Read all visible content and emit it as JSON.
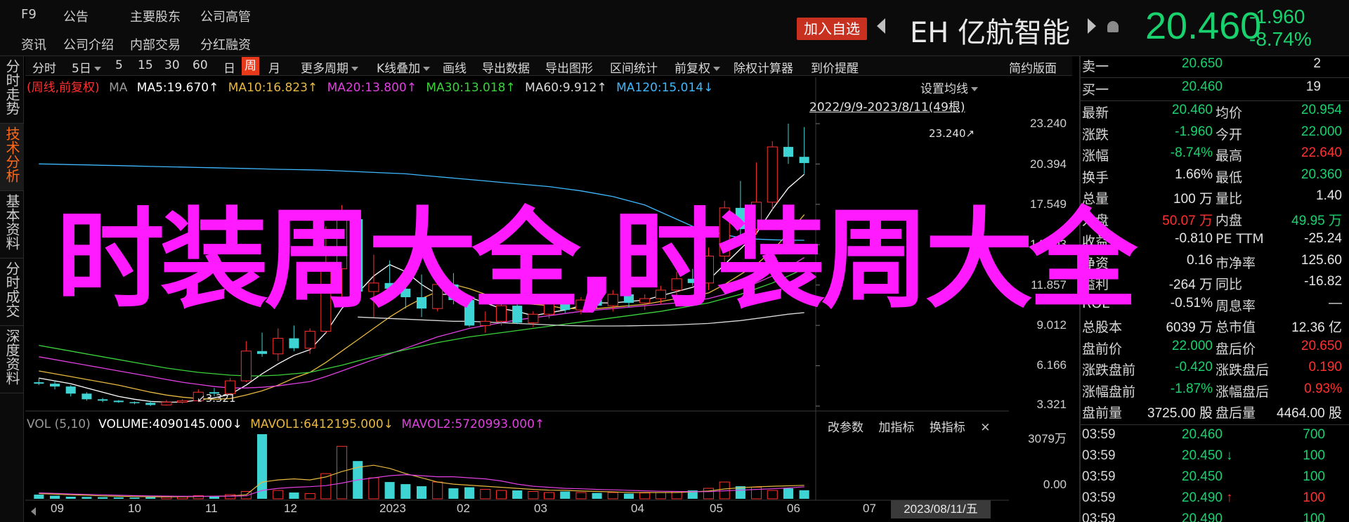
{
  "topnav": [
    "F9",
    "公告",
    "主要股东",
    "公司高管",
    "资讯",
    "公司介绍",
    "内部交易",
    "分红融资"
  ],
  "add_watch_label": "加入自选",
  "stock": {
    "code": "EH",
    "name": "亿航智能",
    "price": "20.460",
    "change": "-1.960",
    "change_pct": "-8.74%"
  },
  "left_tabs": [
    {
      "label": "分时走势",
      "active": false
    },
    {
      "label": "技术分析",
      "active": true
    },
    {
      "label": "基本资料",
      "active": false
    },
    {
      "label": "分时成交",
      "active": false
    },
    {
      "label": "深度资料",
      "active": false
    }
  ],
  "toolbar": {
    "items": [
      "分时",
      "5日",
      "5",
      "15",
      "30",
      "60",
      "日",
      "周",
      "月",
      "更多周期",
      "K线叠加",
      "画线",
      "导出数据",
      "导出图形",
      "区间统计",
      "前复权",
      "除权计算器",
      "到价提醒"
    ],
    "active": "周",
    "simple_layout": "简约版面"
  },
  "ma_legend": {
    "prefix": "(周线,前复权)",
    "ma": "MA",
    "ma5": "MA5:19.670↑",
    "ma10": "MA10:16.823↑",
    "ma20": "MA20:13.800↑",
    "ma30": "MA30:13.018↑",
    "ma60": "MA60:9.912↑",
    "ma120": "MA120:15.014↓"
  },
  "set_ma": "设置均线",
  "date_range": "2022/9/9-2023/8/11(49根)",
  "price_axis": [
    "23.240",
    "20.394",
    "17.549",
    "14.703",
    "11.857",
    "9.012",
    "6.166",
    "3.321"
  ],
  "peak_label": "23.240↗",
  "low_label": "↙3.321",
  "volume": {
    "prefix": "VOL (5,10)",
    "volume": "VOLUME:4090145.000↓",
    "mavol1": "MAVOL1:6412195.000↓",
    "mavol2": "MAVOL2:5720993.000↑",
    "cmds": [
      "改参数",
      "加指标",
      "换指标"
    ],
    "axis": [
      "3079万",
      "0.00"
    ]
  },
  "x_axis": [
    "09",
    "10",
    "11",
    "12",
    "2023",
    "02",
    "03",
    "04",
    "05",
    "06",
    "07"
  ],
  "x_cursor": "2023/08/11/五",
  "order_book": [
    {
      "label": "卖一",
      "price": "20.650",
      "vol": "2"
    },
    {
      "label": "买一",
      "price": "20.460",
      "vol": "19"
    }
  ],
  "quote": [
    {
      "l1": "最新",
      "v1": "20.460",
      "c1": "green",
      "l2": "均价",
      "v2": "20.954",
      "c2": "green"
    },
    {
      "l1": "涨跌",
      "v1": "-1.960",
      "c1": "green",
      "l2": "今开",
      "v2": "22.000",
      "c2": "green"
    },
    {
      "l1": "涨幅",
      "v1": "-8.74%",
      "c1": "green",
      "l2": "最高",
      "v2": "22.640",
      "c2": "red"
    },
    {
      "l1": "换手",
      "v1": "1.66%",
      "c1": "white",
      "l2": "最低",
      "v2": "20.360",
      "c2": "green"
    },
    {
      "l1": "总量",
      "v1": "100 万",
      "c1": "white",
      "l2": "量比",
      "v2": "1.40",
      "c2": "white"
    },
    {
      "l1": "外盘",
      "v1": "50.07 万",
      "c1": "red",
      "l2": "内盘",
      "v2": "49.95 万",
      "c2": "green"
    },
    {
      "l1": "收益",
      "v1": "-0.810",
      "c1": "white",
      "l2": "PE TTM",
      "v2": "-25.24",
      "c2": "white"
    },
    {
      "l1": "净资",
      "v1": "0.16",
      "c1": "white",
      "l2": "市净率",
      "v2": "125.60",
      "c2": "white"
    },
    {
      "l1": "溢利",
      "v1": "-264 万",
      "c1": "white",
      "l2": "同比",
      "v2": "-16.82",
      "c2": "white"
    },
    {
      "l1": "ROE",
      "v1": "-0.51%",
      "c1": "white",
      "l2": "周息率",
      "v2": "—",
      "c2": "white"
    },
    {
      "l1": "总股本",
      "v1": "6039 万",
      "c1": "white",
      "l2": "总市值",
      "v2": "12.36 亿",
      "c2": "white"
    },
    {
      "l1": "盘前价",
      "v1": "22.000",
      "c1": "green",
      "l2": "盘后价",
      "v2": "20.650",
      "c2": "red"
    },
    {
      "l1": "涨跌盘前",
      "v1": "-0.420",
      "c1": "green",
      "l2": "涨跌盘后",
      "v2": "0.190",
      "c2": "red"
    },
    {
      "l1": "涨幅盘前",
      "v1": "-1.87%",
      "c1": "green",
      "l2": "涨幅盘后",
      "v2": "0.93%",
      "c2": "red"
    },
    {
      "l1": "盘前量",
      "v1": "3725.00 股",
      "c1": "white",
      "l2": "盘后量",
      "v2": "4464.00 股",
      "c2": "white"
    }
  ],
  "ticks": [
    {
      "time": "03:59",
      "price": "20.460",
      "dir": "",
      "vol": "700",
      "pc": "green",
      "vc": "green"
    },
    {
      "time": "03:59",
      "price": "20.450",
      "dir": "↓",
      "vol": "100",
      "pc": "green",
      "vc": "green"
    },
    {
      "time": "03:59",
      "price": "20.450",
      "dir": "",
      "vol": "100",
      "pc": "green",
      "vc": "green"
    },
    {
      "time": "03:59",
      "price": "20.490",
      "dir": "↑",
      "vol": "100",
      "pc": "green",
      "vc": "red"
    },
    {
      "time": "03:59",
      "price": "20.490",
      "dir": "",
      "vol": "100",
      "pc": "green",
      "vc": "green"
    }
  ],
  "overlay_title": "时装周大全,时装周大全",
  "colors": {
    "up": "#ff3030",
    "down": "#19d26e",
    "candle_down": "#3fd4d4",
    "accent": "#e8391a",
    "overlay": "#ff1aff"
  },
  "chart_data": {
    "type": "candlestick",
    "period": "weekly",
    "ylim": [
      3.321,
      23.24
    ],
    "candles": [
      {
        "o": 5.0,
        "h": 5.3,
        "l": 4.8,
        "c": 4.9
      },
      {
        "o": 4.9,
        "h": 5.1,
        "l": 4.5,
        "c": 4.7
      },
      {
        "o": 4.7,
        "h": 4.8,
        "l": 4.0,
        "c": 4.2
      },
      {
        "o": 4.2,
        "h": 4.3,
        "l": 3.7,
        "c": 3.8
      },
      {
        "o": 3.8,
        "h": 3.9,
        "l": 3.6,
        "c": 3.7
      },
      {
        "o": 3.7,
        "h": 3.75,
        "l": 3.55,
        "c": 3.6
      },
      {
        "o": 3.6,
        "h": 3.65,
        "l": 3.45,
        "c": 3.55
      },
      {
        "o": 3.55,
        "h": 3.7,
        "l": 3.321,
        "c": 3.4
      },
      {
        "o": 3.4,
        "h": 3.75,
        "l": 3.35,
        "c": 3.6
      },
      {
        "o": 3.6,
        "h": 3.8,
        "l": 3.5,
        "c": 3.7
      },
      {
        "o": 3.7,
        "h": 4.5,
        "l": 3.6,
        "c": 4.3
      },
      {
        "o": 4.3,
        "h": 4.6,
        "l": 4.0,
        "c": 4.2
      },
      {
        "o": 4.2,
        "h": 5.3,
        "l": 4.1,
        "c": 5.1
      },
      {
        "o": 5.1,
        "h": 7.9,
        "l": 5.0,
        "c": 7.2
      },
      {
        "o": 7.2,
        "h": 8.5,
        "l": 6.8,
        "c": 7.0
      },
      {
        "o": 7.0,
        "h": 8.8,
        "l": 6.5,
        "c": 8.1
      },
      {
        "o": 8.1,
        "h": 9.0,
        "l": 7.2,
        "c": 7.4
      },
      {
        "o": 7.4,
        "h": 8.8,
        "l": 7.0,
        "c": 8.6
      },
      {
        "o": 8.6,
        "h": 16.0,
        "l": 8.4,
        "c": 13.0
      },
      {
        "o": 13.0,
        "h": 17.5,
        "l": 10.4,
        "c": 16.5
      },
      {
        "o": 16.5,
        "h": 17.0,
        "l": 11.0,
        "c": 11.4
      },
      {
        "o": 11.4,
        "h": 14.0,
        "l": 9.6,
        "c": 12.0
      },
      {
        "o": 12.0,
        "h": 13.6,
        "l": 10.8,
        "c": 11.6
      },
      {
        "o": 11.6,
        "h": 12.5,
        "l": 10.2,
        "c": 11.0
      },
      {
        "o": 11.0,
        "h": 12.6,
        "l": 9.6,
        "c": 10.2
      },
      {
        "o": 10.2,
        "h": 12.8,
        "l": 10.0,
        "c": 11.9
      },
      {
        "o": 11.9,
        "h": 12.7,
        "l": 10.5,
        "c": 10.8
      },
      {
        "o": 10.8,
        "h": 11.0,
        "l": 8.9,
        "c": 9.0
      },
      {
        "o": 9.0,
        "h": 10.0,
        "l": 8.5,
        "c": 9.3
      },
      {
        "o": 9.3,
        "h": 10.8,
        "l": 9.0,
        "c": 10.4
      },
      {
        "o": 10.4,
        "h": 10.5,
        "l": 9.1,
        "c": 9.2
      },
      {
        "o": 9.2,
        "h": 10.0,
        "l": 8.9,
        "c": 9.8
      },
      {
        "o": 9.8,
        "h": 10.9,
        "l": 9.5,
        "c": 10.6
      },
      {
        "o": 10.6,
        "h": 11.0,
        "l": 9.9,
        "c": 10.1
      },
      {
        "o": 10.1,
        "h": 11.0,
        "l": 9.8,
        "c": 10.8
      },
      {
        "o": 10.8,
        "h": 11.3,
        "l": 10.2,
        "c": 10.4
      },
      {
        "o": 10.4,
        "h": 11.5,
        "l": 10.0,
        "c": 11.2
      },
      {
        "o": 11.2,
        "h": 11.4,
        "l": 10.3,
        "c": 10.6
      },
      {
        "o": 10.6,
        "h": 11.2,
        "l": 10.1,
        "c": 10.9
      },
      {
        "o": 10.9,
        "h": 11.8,
        "l": 10.5,
        "c": 11.5
      },
      {
        "o": 11.5,
        "h": 12.8,
        "l": 11.0,
        "c": 12.3
      },
      {
        "o": 12.3,
        "h": 13.0,
        "l": 11.8,
        "c": 12.0
      },
      {
        "o": 12.0,
        "h": 14.5,
        "l": 11.5,
        "c": 13.9
      },
      {
        "o": 13.9,
        "h": 17.8,
        "l": 13.5,
        "c": 17.3
      },
      {
        "o": 17.3,
        "h": 19.2,
        "l": 15.3,
        "c": 15.8
      },
      {
        "o": 15.8,
        "h": 20.5,
        "l": 15.4,
        "c": 17.7
      },
      {
        "o": 17.7,
        "h": 22.0,
        "l": 17.2,
        "c": 21.6
      },
      {
        "o": 21.6,
        "h": 23.24,
        "l": 20.4,
        "c": 20.9
      },
      {
        "o": 20.9,
        "h": 23.0,
        "l": 19.7,
        "c": 20.46
      }
    ],
    "ma_lines": [
      {
        "name": "MA5",
        "color": "#ffffff",
        "values": [
          5.3,
          5.1,
          4.9,
          4.6,
          4.3,
          4.0,
          3.8,
          3.65,
          3.6,
          3.6,
          3.75,
          3.9,
          4.15,
          4.8,
          5.6,
          6.3,
          6.9,
          7.3,
          8.5,
          10.2,
          11.3,
          12.5,
          13.3,
          12.8,
          11.9,
          11.2,
          11.2,
          11.0,
          10.6,
          10.2,
          10.0,
          9.7,
          9.9,
          10.1,
          10.4,
          10.6,
          10.6,
          10.7,
          10.8,
          11.1,
          11.4,
          11.7,
          12.2,
          13.3,
          14.4,
          15.5,
          17.2,
          18.7,
          19.67
        ]
      },
      {
        "name": "MA10",
        "color": "#e8b840",
        "values": [
          5.8,
          5.6,
          5.4,
          5.2,
          5.0,
          4.8,
          4.55,
          4.3,
          4.1,
          3.95,
          3.85,
          3.8,
          3.85,
          4.1,
          4.4,
          4.8,
          5.3,
          5.7,
          6.4,
          7.2,
          8.0,
          8.8,
          9.6,
          10.3,
          10.9,
          11.4,
          11.9,
          11.6,
          11.2,
          10.9,
          10.6,
          10.5,
          10.4,
          10.2,
          10.2,
          10.2,
          10.3,
          10.4,
          10.5,
          10.7,
          10.9,
          11.1,
          11.3,
          11.9,
          12.6,
          13.3,
          14.3,
          15.5,
          16.82
        ]
      },
      {
        "name": "MA20",
        "color": "#e040e0",
        "values": [
          6.8,
          6.6,
          6.4,
          6.2,
          6.0,
          5.8,
          5.6,
          5.4,
          5.2,
          5.0,
          4.85,
          4.7,
          4.6,
          4.6,
          4.65,
          4.75,
          4.9,
          5.05,
          5.4,
          5.8,
          6.2,
          6.6,
          7.0,
          7.4,
          7.8,
          8.2,
          8.5,
          8.8,
          9.0,
          9.2,
          9.4,
          9.55,
          9.7,
          9.85,
          10.0,
          10.1,
          10.2,
          10.3,
          10.4,
          10.5,
          10.6,
          10.75,
          10.9,
          11.2,
          11.6,
          12.0,
          12.5,
          13.1,
          13.8
        ]
      },
      {
        "name": "MA30",
        "color": "#3bd23b",
        "values": [
          7.6,
          7.4,
          7.2,
          7.0,
          6.8,
          6.6,
          6.4,
          6.2,
          6.0,
          5.85,
          5.7,
          5.6,
          5.5,
          5.45,
          5.45,
          5.5,
          5.6,
          5.7,
          5.95,
          6.2,
          6.5,
          6.8,
          7.05,
          7.3,
          7.55,
          7.8,
          8.0,
          8.2,
          8.35,
          8.5,
          8.65,
          8.8,
          8.95,
          9.1,
          9.25,
          9.4,
          9.55,
          9.7,
          9.85,
          10.0,
          10.2,
          10.4,
          10.6,
          10.9,
          11.2,
          11.6,
          12.0,
          12.5,
          13.018
        ]
      },
      {
        "name": "MA60",
        "color": "#d8d8d8",
        "values": [
          null,
          null,
          null,
          null,
          null,
          null,
          null,
          null,
          null,
          null,
          null,
          null,
          null,
          null,
          null,
          null,
          null,
          null,
          null,
          null,
          9.6,
          9.55,
          9.5,
          9.45,
          9.4,
          9.35,
          9.3,
          9.3,
          9.25,
          9.2,
          9.15,
          9.1,
          9.05,
          9.0,
          8.98,
          8.97,
          8.97,
          8.98,
          9.0,
          9.02,
          9.05,
          9.1,
          9.15,
          9.25,
          9.35,
          9.5,
          9.65,
          9.8,
          9.912
        ]
      },
      {
        "name": "MA120",
        "color": "#40b8ff",
        "values": [
          20.4,
          20.38,
          20.35,
          20.33,
          20.3,
          20.28,
          20.25,
          20.22,
          20.2,
          20.18,
          20.15,
          20.13,
          20.1,
          20.08,
          20.05,
          20.02,
          20.0,
          19.98,
          19.95,
          19.9,
          19.85,
          19.8,
          19.75,
          19.7,
          19.6,
          19.5,
          19.4,
          19.3,
          19.2,
          19.1,
          19.0,
          18.9,
          18.8,
          18.65,
          18.5,
          18.3,
          18.1,
          17.8,
          17.5,
          17.0,
          16.5,
          16.0,
          15.7,
          15.4,
          15.2,
          15.1,
          15.05,
          15.02,
          15.014
        ]
      }
    ],
    "volume": [
      2.0,
      1.5,
      1.0,
      0.9,
      0.8,
      0.7,
      0.6,
      0.8,
      0.9,
      1.0,
      1.5,
      1.3,
      2.0,
      3.5,
      30.79,
      4.0,
      3.0,
      2.5,
      12.0,
      25.0,
      18.0,
      10.0,
      8.0,
      7.0,
      6.0,
      8.0,
      5.0,
      5.5,
      4.5,
      4.0,
      4.0,
      3.5,
      3.0,
      3.5,
      3.0,
      2.8,
      3.0,
      2.5,
      2.8,
      3.0,
      3.5,
      4.0,
      5.0,
      8.0,
      6.0,
      5.5,
      4.0,
      5.0,
      4.09
    ],
    "mavol1": [
      2.5,
      2.2,
      1.9,
      1.7,
      1.4,
      1.2,
      1.1,
      1.0,
      0.95,
      1.0,
      1.1,
      1.2,
      1.4,
      1.9,
      8.0,
      9.0,
      9.5,
      9.0,
      10.4,
      13.0,
      15.0,
      16.0,
      14.5,
      12.0,
      10.0,
      8.0,
      7.0,
      6.5,
      6.0,
      5.5,
      5.0,
      4.5,
      4.1,
      4.0,
      3.7,
      3.5,
      3.3,
      3.0,
      3.0,
      3.0,
      3.0,
      3.3,
      3.7,
      4.7,
      5.3,
      5.7,
      6.0,
      6.2,
      6.41
    ],
    "mavol2": [
      2.8,
      2.6,
      2.3,
      2.1,
      1.9,
      1.7,
      1.5,
      1.4,
      1.3,
      1.2,
      1.2,
      1.2,
      1.3,
      1.4,
      4.0,
      5.0,
      5.5,
      5.8,
      6.3,
      7.5,
      9.0,
      10.0,
      11.0,
      11.5,
      11.0,
      10.5,
      10.5,
      10.0,
      9.5,
      8.5,
      7.0,
      6.0,
      5.5,
      5.0,
      4.8,
      4.5,
      4.3,
      4.0,
      3.8,
      3.6,
      3.5,
      3.4,
      3.4,
      3.8,
      4.1,
      4.5,
      4.8,
      5.2,
      5.72
    ]
  }
}
